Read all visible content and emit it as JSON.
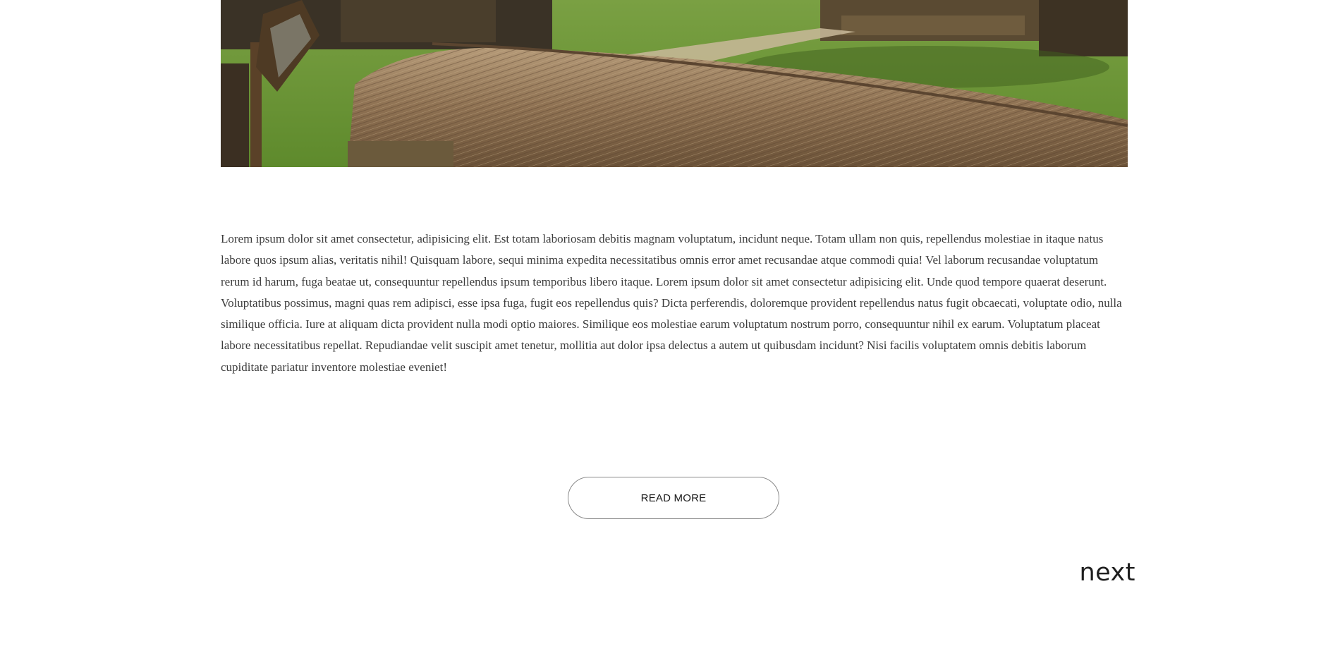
{
  "hero": {
    "image_description_icon": "thatched-fence-photo"
  },
  "article": {
    "body": "Lorem ipsum dolor sit amet consectetur, adipisicing elit. Est totam laboriosam debitis magnam voluptatum, incidunt neque. Totam ullam non quis, repellendus molestiae in itaque natus labore quos ipsum alias, veritatis nihil! Quisquam labore, sequi minima expedita necessitatibus omnis error amet recusandae atque commodi quia! Vel laborum recusandae voluptatum rerum id harum, fuga beatae ut, consequuntur repellendus ipsum temporibus libero itaque. Lorem ipsum dolor sit amet consectetur adipisicing elit. Unde quod tempore quaerat deserunt. Voluptatibus possimus, magni quas rem adipisci, esse ipsa fuga, fugit eos repellendus quis? Dicta perferendis, doloremque provident repellendus natus fugit obcaecati, voluptate odio, nulla similique officia. Iure at aliquam dicta provident nulla modi optio maiores. Similique eos molestiae earum voluptatum nostrum porro, consequuntur nihil ex earum. Voluptatum placeat labore necessitatibus repellat. Repudiandae velit suscipit amet tenetur, mollitia aut dolor ipsa delectus a autem ut quibusdam incidunt? Nisi facilis voluptatem omnis debitis laborum cupiditate pariatur inventore molestiae eveniet!"
  },
  "actions": {
    "read_more_label": "READ MORE",
    "next_label": "next"
  },
  "colors": {
    "text": "#3c3c3c",
    "button_border": "#8a8a8a",
    "background": "#ffffff"
  }
}
